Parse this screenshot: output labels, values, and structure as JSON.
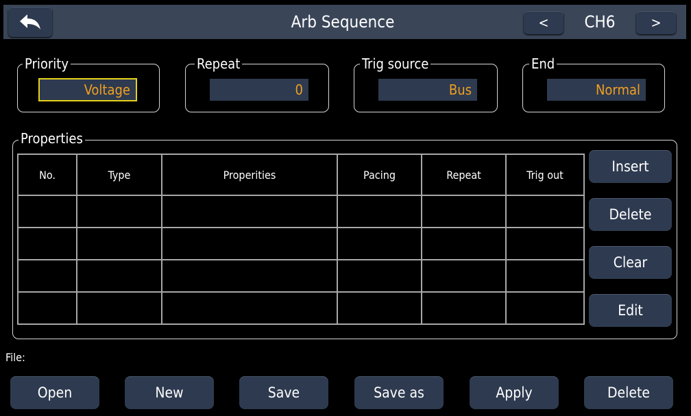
{
  "header": {
    "title": "Arb Sequence",
    "channel": "CH6",
    "prev": "<",
    "next": ">"
  },
  "fields": {
    "priority": {
      "label": "Priority",
      "value": "Voltage"
    },
    "repeat": {
      "label": "Repeat",
      "value": "0"
    },
    "trig_source": {
      "label": "Trig source",
      "value": "Bus"
    },
    "end": {
      "label": "End",
      "value": "Normal"
    }
  },
  "properties": {
    "label": "Properties",
    "columns": [
      "No.",
      "Type",
      "Properities",
      "Pacing",
      "Repeat",
      "Trig out"
    ],
    "buttons": {
      "insert": "Insert",
      "delete": "Delete",
      "clear": "Clear",
      "edit": "Edit"
    }
  },
  "file": {
    "label": "File:",
    "buttons": {
      "open": "Open",
      "new": "New",
      "save": "Save",
      "save_as": "Save as",
      "apply": "Apply",
      "delete": "Delete"
    }
  },
  "colors": {
    "accent_value": "#f0a020",
    "button_bg": "#2e3a4f",
    "focus_border": "#e6d21a"
  }
}
